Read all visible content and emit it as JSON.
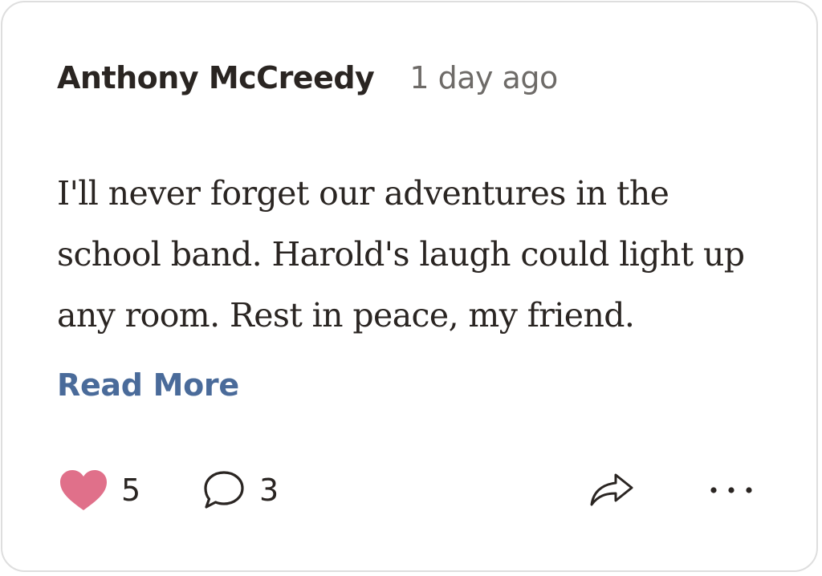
{
  "comment": {
    "author": "Anthony McCreedy",
    "time": "1 day ago",
    "text": "I'll never forget our adventures in the school band. Harold's laugh could light up any room. Rest in peace, my friend.",
    "read_more_label": "Read More"
  },
  "actions": {
    "like_count": "5",
    "comment_count": "3",
    "like_icon": "heart-icon",
    "comment_icon": "speech-bubble-icon",
    "share_icon": "share-arrow-icon",
    "more_icon": "more-dots-icon"
  },
  "colors": {
    "heart": "#e0708a",
    "link": "#4a6b9a",
    "text": "#2a2522",
    "muted": "#6e6b68",
    "border": "#dedede"
  }
}
